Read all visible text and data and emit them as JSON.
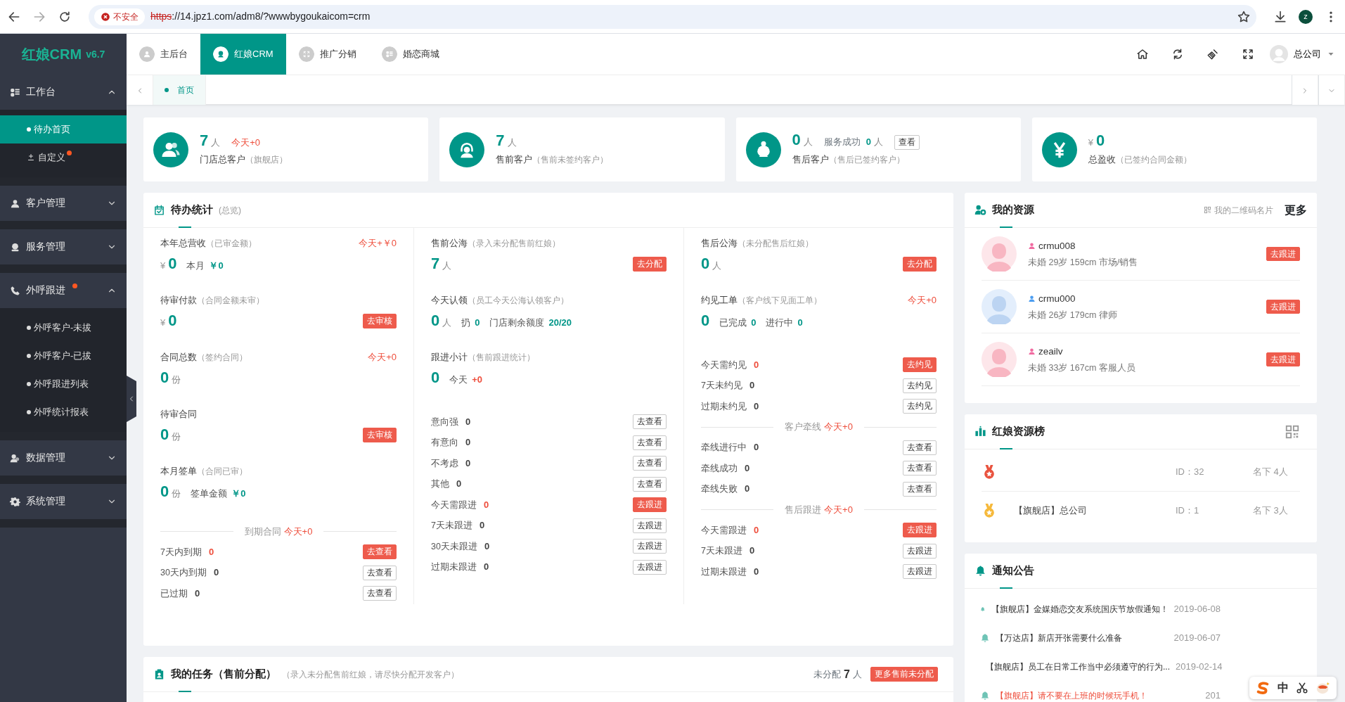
{
  "browser": {
    "security": "不安全",
    "url": [
      {
        "text": "https",
        "insecure": true
      },
      {
        "text": "://14.jpz1.com/adm8/?wwwbygoukaicom=crm",
        "insecure": false
      }
    ],
    "profile": "z"
  },
  "sidebar": {
    "logo": "红娘CRM",
    "version": "v6.7",
    "groups": [
      {
        "label": "工作台",
        "expanded": true,
        "alert": false,
        "items": [
          {
            "label": "待办首页",
            "selected": true,
            "kind": "bullet",
            "alert": false
          },
          {
            "label": "自定义",
            "selected": false,
            "kind": "icon",
            "alert": true
          }
        ]
      },
      {
        "label": "客户管理",
        "expanded": false,
        "alert": false
      },
      {
        "label": "服务管理",
        "expanded": false,
        "alert": false
      },
      {
        "label": "外呼跟进",
        "expanded": true,
        "alert": true,
        "items": [
          {
            "label": "外呼客户-未拔",
            "selected": false,
            "kind": "bullet",
            "alert": false
          },
          {
            "label": "外呼客户-已拔",
            "selected": false,
            "kind": "bullet",
            "alert": false
          },
          {
            "label": "外呼跟进列表",
            "selected": false,
            "kind": "bullet",
            "alert": false
          },
          {
            "label": "外呼统计报表",
            "selected": false,
            "kind": "bullet",
            "alert": false
          }
        ]
      },
      {
        "label": "数据管理",
        "expanded": false,
        "alert": false
      },
      {
        "label": "系统管理",
        "expanded": false,
        "alert": false
      }
    ]
  },
  "topnav": {
    "tabs": [
      {
        "label": "主后台",
        "selected": false
      },
      {
        "label": "红娘CRM",
        "selected": true
      },
      {
        "label": "推广分销",
        "selected": false
      },
      {
        "label": "婚恋商城",
        "selected": false
      }
    ],
    "user": "总公司"
  },
  "page_tabs": [
    {
      "label": "首页",
      "selected": true
    }
  ],
  "stat_cards": [
    {
      "value": "7",
      "unit": "人",
      "today": "今天+0",
      "title": "门店总客户",
      "note": "（旗舰店）"
    },
    {
      "value": "7",
      "unit": "人",
      "title": "售前客户",
      "note": "（售前未签约客户）"
    },
    {
      "value": "0",
      "unit": "人",
      "extra": {
        "label": "服务成功",
        "value": "0",
        "unit": "人",
        "button": "查看"
      },
      "title": "售后客户",
      "note": "（售后已签约客户）"
    },
    {
      "prefix": "¥",
      "value": "0",
      "title": "总盈收",
      "note": "（已签约合同金额）"
    }
  ],
  "todo": {
    "title": "待办统计",
    "note": "(总览)",
    "columns": [
      [
        {
          "kind": "stat",
          "title": "本年总营收",
          "note": "（已审金额）",
          "today": "今天+￥0",
          "prefix": "¥",
          "value": "0",
          "inline": [
            {
              "label": "本月",
              "value": "￥0",
              "alert": false
            }
          ]
        },
        {
          "kind": "stat",
          "title": "待审付款",
          "note": "（合同金额未审）",
          "prefix": "¥",
          "value": "0",
          "action": {
            "label": "去审核",
            "filled": true
          }
        },
        {
          "kind": "stat",
          "title": "合同总数",
          "note": "（签约合同）",
          "today": "今天+0",
          "value": "0",
          "unit": "份"
        },
        {
          "kind": "stat",
          "title": "待审合同",
          "value": "0",
          "unit": "份",
          "action": {
            "label": "去审核",
            "filled": true
          }
        },
        {
          "kind": "stat",
          "title": "本月签单",
          "note": "（合同已审）",
          "value": "0",
          "unit": "份",
          "inline": [
            {
              "label": "签单金额",
              "value": "￥0",
              "alert": false
            }
          ]
        },
        {
          "kind": "divider",
          "label": "到期合同",
          "today": "今天+0"
        },
        {
          "kind": "row",
          "label": "7天内到期",
          "value": "0",
          "alert": true,
          "action": {
            "label": "去查看",
            "filled": true
          }
        },
        {
          "kind": "row",
          "label": "30天内到期",
          "value": "0",
          "alert": false,
          "action": {
            "label": "去查看",
            "filled": false
          }
        },
        {
          "kind": "row",
          "label": "已过期",
          "value": "0",
          "alert": false,
          "action": {
            "label": "去查看",
            "filled": false
          }
        }
      ],
      [
        {
          "kind": "stat",
          "title": "售前公海",
          "note": "（录入未分配售前红娘）",
          "value": "7",
          "unit": "人",
          "action": {
            "label": "去分配",
            "filled": true
          }
        },
        {
          "kind": "stat",
          "title": "今天认领",
          "note": "（员工今天公海认领客户）",
          "value": "0",
          "unit": "人",
          "inline": [
            {
              "label": "扔",
              "value": "0",
              "alert": false
            },
            {
              "label": "门店剩余额度",
              "value": "20/20",
              "alert": false
            }
          ]
        },
        {
          "kind": "stat",
          "title": "跟进小计",
          "note": "（售前跟进统计）",
          "value": "0",
          "inline": [
            {
              "label": "今天",
              "value": "+0",
              "alert": true
            }
          ]
        },
        {
          "kind": "row",
          "label": "意向强",
          "value": "0",
          "alert": false,
          "action": {
            "label": "去查看",
            "filled": false
          }
        },
        {
          "kind": "row",
          "label": "有意向",
          "value": "0",
          "alert": false,
          "action": {
            "label": "去查看",
            "filled": false
          }
        },
        {
          "kind": "row",
          "label": "不考虑",
          "value": "0",
          "alert": false,
          "action": {
            "label": "去查看",
            "filled": false
          }
        },
        {
          "kind": "row",
          "label": "其他",
          "value": "0",
          "alert": false,
          "action": {
            "label": "去查看",
            "filled": false
          }
        },
        {
          "kind": "row",
          "label": "今天需跟进",
          "value": "0",
          "alert": true,
          "action": {
            "label": "去跟进",
            "filled": true
          }
        },
        {
          "kind": "row",
          "label": "7天未跟进",
          "value": "0",
          "alert": false,
          "action": {
            "label": "去跟进",
            "filled": false
          }
        },
        {
          "kind": "row",
          "label": "30天未跟进",
          "value": "0",
          "alert": false,
          "action": {
            "label": "去跟进",
            "filled": false
          }
        },
        {
          "kind": "row",
          "label": "过期未跟进",
          "value": "0",
          "alert": false,
          "action": {
            "label": "去跟进",
            "filled": false
          }
        }
      ],
      [
        {
          "kind": "stat",
          "title": "售后公海",
          "note": "（未分配售后红娘）",
          "value": "0",
          "unit": "人",
          "action": {
            "label": "去分配",
            "filled": true
          }
        },
        {
          "kind": "stat",
          "title": "约见工单",
          "note": "（客户线下见面工单）",
          "today": "今天+0",
          "value": "0",
          "inline": [
            {
              "label": "已完成",
              "value": "0",
              "alert": false
            },
            {
              "label": "进行中",
              "value": "0",
              "alert": false
            }
          ]
        },
        {
          "kind": "row",
          "label": "今天需约见",
          "value": "0",
          "alert": true,
          "action": {
            "label": "去约见",
            "filled": true
          }
        },
        {
          "kind": "row",
          "label": "7天未约见",
          "value": "0",
          "alert": false,
          "action": {
            "label": "去约见",
            "filled": false
          }
        },
        {
          "kind": "row",
          "label": "过期未约见",
          "value": "0",
          "alert": false,
          "action": {
            "label": "去约见",
            "filled": false
          }
        },
        {
          "kind": "divider",
          "label": "客户牵线",
          "today": "今天+0"
        },
        {
          "kind": "row",
          "label": "牵线进行中",
          "value": "0",
          "alert": false,
          "action": {
            "label": "去查看",
            "filled": false
          }
        },
        {
          "kind": "row",
          "label": "牵线成功",
          "value": "0",
          "alert": false,
          "action": {
            "label": "去查看",
            "filled": false
          }
        },
        {
          "kind": "row",
          "label": "牵线失败",
          "value": "0",
          "alert": false,
          "action": {
            "label": "去查看",
            "filled": false
          }
        },
        {
          "kind": "divider",
          "label": "售后跟进",
          "today": "今天+0"
        },
        {
          "kind": "row",
          "label": "今天需跟进",
          "value": "0",
          "alert": true,
          "action": {
            "label": "去跟进",
            "filled": true
          }
        },
        {
          "kind": "row",
          "label": "7天未跟进",
          "value": "0",
          "alert": false,
          "action": {
            "label": "去跟进",
            "filled": false
          }
        },
        {
          "kind": "row",
          "label": "过期未跟进",
          "value": "0",
          "alert": false,
          "action": {
            "label": "去跟进",
            "filled": false
          }
        }
      ]
    ]
  },
  "tasks": {
    "title": "我的任务（售前分配）",
    "note": "（录入未分配售前红娘，请尽快分配开发客户）",
    "label": "未分配",
    "value": "7",
    "unit": "人",
    "button": "更多售前未分配"
  },
  "resources": {
    "title": "我的资源",
    "link": "我的二维码名片",
    "more": "更多",
    "items": [
      {
        "kind": "female",
        "name": "crmu008",
        "info": "未婚 29岁 159cm 市场/销售",
        "action": "去跟进"
      },
      {
        "kind": "male",
        "name": "crmu000",
        "info": "未婚 26岁 179cm 律师",
        "action": "去跟进"
      },
      {
        "kind": "female",
        "name": "zeailv",
        "info": "未婚 33岁 167cm 客服人员",
        "action": "去跟进"
      }
    ]
  },
  "ranking": {
    "title": "红娘资源榜",
    "rows": [
      {
        "color": "#e9533f",
        "id": "ID：32",
        "count": "名下 4人"
      },
      {
        "color": "#f6b93b",
        "name": "【旗舰店】总公司",
        "id": "ID：1",
        "count": "名下 3人"
      }
    ]
  },
  "notices": {
    "title": "通知公告",
    "items": [
      {
        "text": "【旗舰店】金媒婚恋交友系统国庆节放假通知！",
        "date": "2019-06-08",
        "alert": false
      },
      {
        "text": "【万达店】新店开张需要什么准备",
        "date": "2019-06-07",
        "alert": false
      },
      {
        "text": "【旗舰店】员工在日常工作当中必须遵守的行为...",
        "date": "2019-02-14",
        "alert": false
      },
      {
        "text": "【旗舰店】请不要在上班的时候玩手机！",
        "date": "201",
        "alert": true
      }
    ]
  },
  "ime": {
    "label": "中"
  }
}
